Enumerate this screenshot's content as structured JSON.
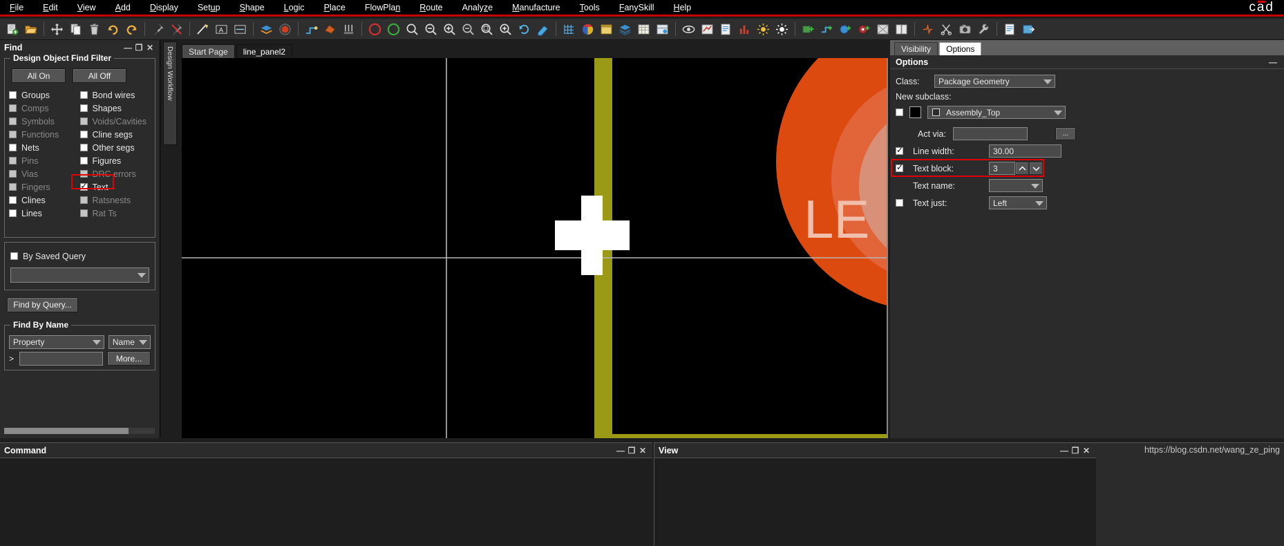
{
  "menu": {
    "items": [
      {
        "label": "File",
        "accel": "F"
      },
      {
        "label": "Edit",
        "accel": "E"
      },
      {
        "label": "View",
        "accel": "V"
      },
      {
        "label": "Add",
        "accel": "A"
      },
      {
        "label": "Display",
        "accel": "D"
      },
      {
        "label": "Setup",
        "accel": "u"
      },
      {
        "label": "Shape",
        "accel": "S"
      },
      {
        "label": "Logic",
        "accel": "L"
      },
      {
        "label": "Place",
        "accel": "P"
      },
      {
        "label": "FlowPlan",
        "accel": "n"
      },
      {
        "label": "Route",
        "accel": "R"
      },
      {
        "label": "Analyze",
        "accel": "z"
      },
      {
        "label": "Manufacture",
        "accel": "M"
      },
      {
        "label": "Tools",
        "accel": "T"
      },
      {
        "label": "FanySkill",
        "accel": "F"
      },
      {
        "label": "Help",
        "accel": "H"
      }
    ],
    "brand": "cad"
  },
  "toolbar": {
    "groups": [
      [
        "new-file-icon",
        "open-folder-icon"
      ],
      [
        "move-icon",
        "copy-icon",
        "delete-icon",
        "undo-icon",
        "redo-icon"
      ],
      [
        "pin-icon",
        "unpin-icon"
      ],
      [
        "line-icon",
        "rect-text-icon",
        "dimension-icon"
      ],
      [
        "layers-icon",
        "sphere-icon"
      ],
      [
        "route-icon",
        "shape-fill-icon",
        "bus-icon"
      ],
      [
        "circle-red-icon",
        "circle-green-icon",
        "zoom-fit-icon",
        "zoom-out-icon",
        "zoom-in-icon",
        "zoom-minus-icon",
        "zoom-window-icon",
        "zoom-plus-icon",
        "refresh-icon",
        "highlight-icon"
      ],
      [
        "grid-icon",
        "color-icon",
        "window-icon",
        "stack-icon",
        "table-icon",
        "db-icon"
      ],
      [
        "eye-icon",
        "measure-icon",
        "report-icon",
        "chart-icon",
        "brightness-icon",
        "contrast-icon"
      ],
      [
        "add-comp-icon",
        "add-net-icon",
        "add-shape-icon",
        "add-via-icon",
        "box-icon",
        "split-icon"
      ],
      [
        "drc-icon",
        "cut-icon",
        "camera-icon",
        "tools-icon"
      ],
      [
        "doc-icon",
        "export-icon"
      ]
    ]
  },
  "left_dock": {
    "vertical_tab": "Design Workflow"
  },
  "find_panel": {
    "title": "Find",
    "minimize_label": "—",
    "restore_label": "❐",
    "close_label": "✕",
    "filter_group": "Design Object Find Filter",
    "all_on": "All On",
    "all_off": "All Off",
    "left_column": [
      {
        "label": "Groups",
        "checked": false,
        "disabled": false
      },
      {
        "label": "Comps",
        "checked": false,
        "disabled": true
      },
      {
        "label": "Symbols",
        "checked": false,
        "disabled": true
      },
      {
        "label": "Functions",
        "checked": false,
        "disabled": true
      },
      {
        "label": "Nets",
        "checked": false,
        "disabled": false
      },
      {
        "label": "Pins",
        "checked": false,
        "disabled": true
      },
      {
        "label": "Vias",
        "checked": false,
        "disabled": true
      },
      {
        "label": "Fingers",
        "checked": false,
        "disabled": true
      },
      {
        "label": "Clines",
        "checked": false,
        "disabled": false
      },
      {
        "label": "Lines",
        "checked": false,
        "disabled": false
      }
    ],
    "right_column": [
      {
        "label": "Bond wires",
        "checked": false,
        "disabled": false
      },
      {
        "label": "Shapes",
        "checked": false,
        "disabled": false
      },
      {
        "label": "Voids/Cavities",
        "checked": false,
        "disabled": true
      },
      {
        "label": "Cline segs",
        "checked": false,
        "disabled": false
      },
      {
        "label": "Other segs",
        "checked": false,
        "disabled": false
      },
      {
        "label": "Figures",
        "checked": false,
        "disabled": false
      },
      {
        "label": "DRC errors",
        "checked": false,
        "disabled": true
      },
      {
        "label": "Text",
        "checked": true,
        "disabled": false,
        "highlighted": true
      },
      {
        "label": "Ratsnests",
        "checked": false,
        "disabled": true
      },
      {
        "label": "Rat Ts",
        "checked": false,
        "disabled": true
      }
    ],
    "by_saved_query": {
      "label": "By Saved Query",
      "checked": false,
      "value": ""
    },
    "find_by_query_button": "Find by Query...",
    "find_by_name_group": "Find By Name",
    "property_select": "Property",
    "name_select": "Name",
    "prompt": ">",
    "name_input_value": "",
    "more_button": "More..."
  },
  "tabs": {
    "items": [
      {
        "label": "Start Page",
        "active": false
      },
      {
        "label": "line_panel2",
        "active": true
      }
    ]
  },
  "canvas": {
    "artwork_text": "LE",
    "colors": {
      "background": "#000000",
      "crosshair": "#ffffff",
      "grid_line": "#b0b0b0",
      "olive_band": "#9a9a16",
      "dark_red": "#8d0b07",
      "orange": "#dd4a10",
      "orange_light": "#e2653a",
      "salmon": "#d99078",
      "letter_fill": "#f0c0ac"
    }
  },
  "right_dock": {
    "tabs": [
      {
        "label": "Visibility",
        "active": false
      },
      {
        "label": "Options",
        "active": true
      }
    ],
    "panel_title": "Options",
    "minimize_label": "—",
    "fields": {
      "class_label": "Class:",
      "class_value": "Package Geometry",
      "new_subclass_label": "New subclass:",
      "subclass_value": "Assembly_Top",
      "act_via_label": "Act via:",
      "act_via_value": "",
      "act_via_browse": "...",
      "line_width_label": "Line width:",
      "line_width_value": "30.00",
      "line_width_checked": true,
      "text_block_label": "Text block:",
      "text_block_value": "3",
      "text_block_checked": true,
      "text_block_highlighted": true,
      "text_name_label": "Text name:",
      "text_name_value": "",
      "text_just_label": "Text just:",
      "text_just_value": "Left",
      "text_just_checked": false
    }
  },
  "command_panel": {
    "title": "Command",
    "minimize_label": "—",
    "restore_label": "❐",
    "close_label": "✕"
  },
  "view_panel": {
    "title": "View",
    "minimize_label": "—",
    "restore_label": "❐",
    "close_label": "✕"
  },
  "watermark": {
    "url": "https://blog.csdn.net/wang_ze_ping"
  }
}
